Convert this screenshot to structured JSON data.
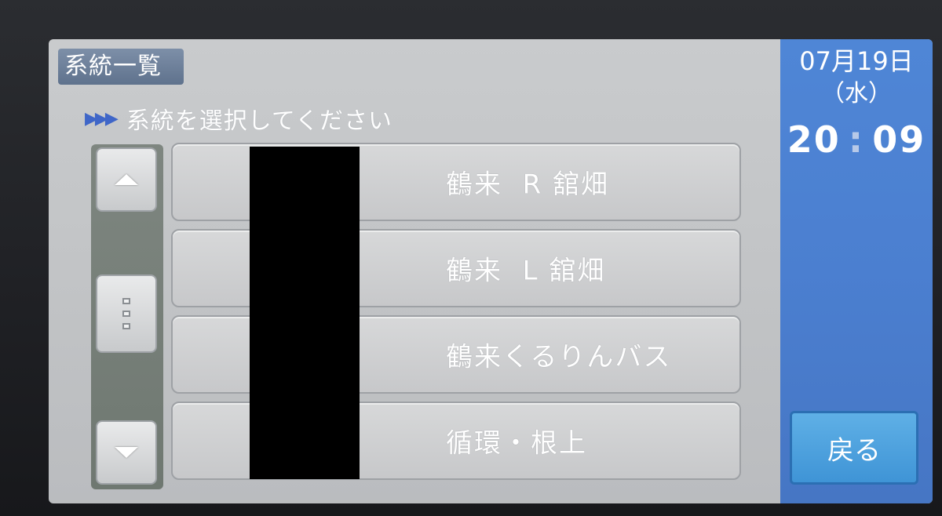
{
  "header": {
    "title": "系統一覧",
    "instruction": "系統を選択してください"
  },
  "scroll": {
    "up_icon": "triangle-up-icon",
    "thumb_icon": "grip-icon",
    "down_icon": "triangle-down-icon"
  },
  "routes": [
    {
      "label": "鶴来  R 舘畑"
    },
    {
      "label": "鶴来  L 舘畑"
    },
    {
      "label": "鶴来くるりんバス"
    },
    {
      "label": "循環・根上"
    }
  ],
  "side": {
    "date": "07月19日",
    "weekday": "（水）",
    "hour": "20",
    "colon": ":",
    "minute": "09",
    "back_label": "戻る"
  },
  "colors": {
    "panel_blue": "#4b7fd0",
    "back_button": "#3f94d6",
    "screen_gray": "#c4c6c8"
  }
}
